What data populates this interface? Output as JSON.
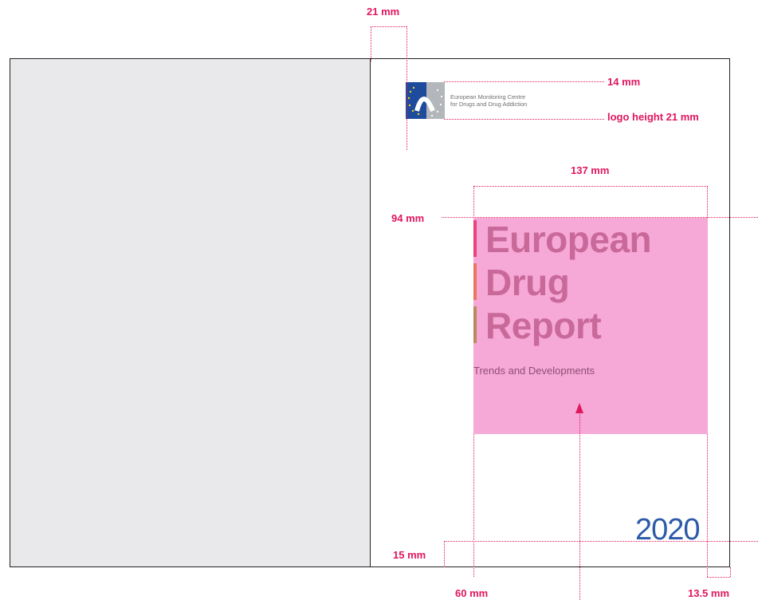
{
  "cover": {
    "logo_text_line1": "European Monitoring Centre",
    "logo_text_line2": "for Drugs and Drug Addiction",
    "title_line1": "European",
    "title_line2": "Drug",
    "title_line3": "Report",
    "subtitle": "Trends and Developments",
    "year": "2020"
  },
  "dimensions": {
    "logo_margin": "21 mm",
    "logo_top": "14 mm",
    "logo_height": "logo height 21 mm",
    "title_box_width": "137 mm",
    "title_box_top": "94 mm",
    "bottom_margin": "15 mm",
    "left_margin": "60 mm",
    "right_margin": "13.5 mm"
  },
  "colors": {
    "annotation": "#e0165f",
    "title_box": "#f6a8d6",
    "title_text": "#c9699a",
    "year": "#2b5aa8",
    "back_cover": "#e9e9eb",
    "title_bar_1": "#e9437b",
    "title_bar_2": "#e8775f",
    "title_bar_3": "#b98a5e"
  }
}
